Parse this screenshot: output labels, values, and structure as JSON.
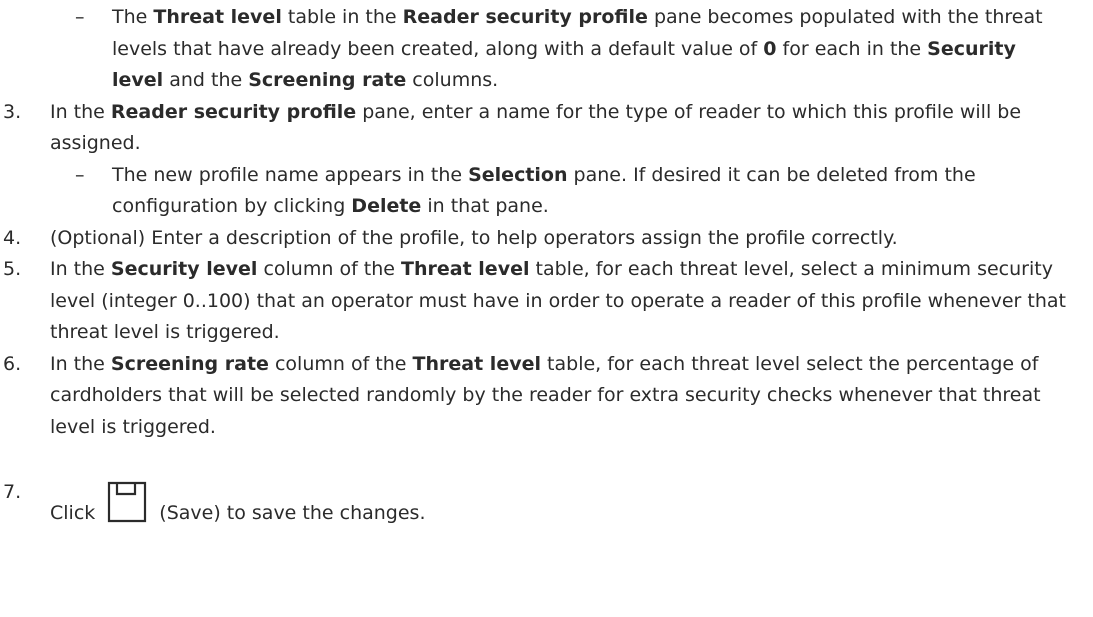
{
  "sub1": {
    "bullet": "–",
    "t1": "The ",
    "b1": "Threat level",
    "t2": " table in the ",
    "b2": "Reader security profile",
    "t3": " pane becomes populated with the threat levels that have already been created, along with a default value of ",
    "b3": "0",
    "t4": " for each in the ",
    "b4": "Security level",
    "t5": " and the ",
    "b5": "Screening rate",
    "t6": " columns."
  },
  "step3": {
    "num": "3.",
    "t1": "In the ",
    "b1": "Reader security profile",
    "t2": " pane, enter a name for the type of reader to which this profile will be assigned."
  },
  "sub2": {
    "bullet": "–",
    "t1": "The new profile name appears in the ",
    "b1": "Selection",
    "t2": " pane. If desired it can be deleted from the configuration by clicking ",
    "b2": "Delete",
    "t3": " in that pane."
  },
  "step4": {
    "num": "4.",
    "t1": "(Optional) Enter a description of the profile, to help operators assign the profile correctly."
  },
  "step5": {
    "num": "5.",
    "t1": "In the ",
    "b1": "Security level",
    "t2": " column of the ",
    "b2": "Threat level",
    "t3": " table, for each threat level, select a minimum security level (integer 0..100) that an operator must have in order to operate a reader of this profile whenever that threat level is triggered."
  },
  "step6": {
    "num": "6.",
    "t1": "In the ",
    "b1": "Screening rate",
    "t2": " column of the ",
    "b2": "Threat level",
    "t3": " table, for each threat level select the percentage of cardholders that will be selected randomly by the reader for extra security checks whenever that threat level is triggered."
  },
  "step7": {
    "num": "7.",
    "t1": "Click",
    "icon": "save-icon",
    "t2": "(Save) to save the changes."
  }
}
